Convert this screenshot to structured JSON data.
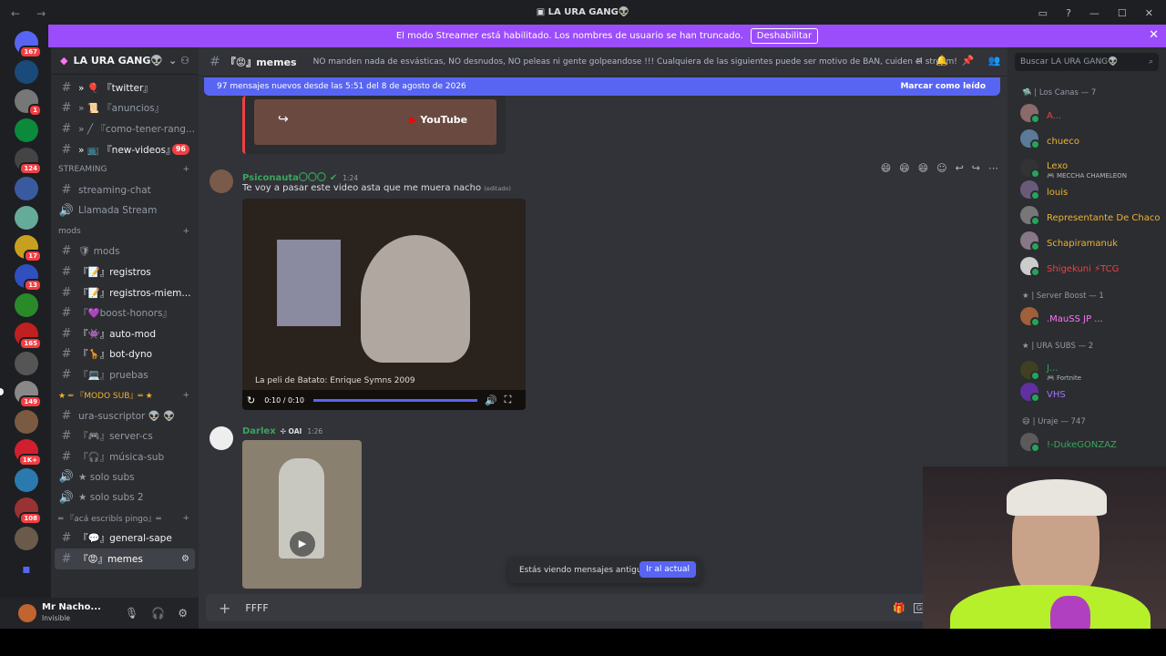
{
  "window": {
    "title": "LA URA GANG👽"
  },
  "banner": {
    "text": "El modo Streamer está habilitado. Los nombres de usuario se han truncado.",
    "button": "Deshabilitar"
  },
  "server_badges": [
    "167",
    "1",
    "124",
    "17",
    "13",
    "165",
    "149",
    "1K+",
    "108"
  ],
  "guild": {
    "name": "LA URA GANG👽"
  },
  "channels": [
    {
      "icon": "#",
      "label": "» 🎈 『twitter』",
      "unread": true
    },
    {
      "icon": "#",
      "label": "» 📜 『anuncios』",
      "unread": false
    },
    {
      "icon": "#",
      "label": "» ╱ 『como-tener-rang...",
      "unread": false
    },
    {
      "icon": "#",
      "label": "» 📺 『new-videos』",
      "unread": true,
      "badge": "96"
    }
  ],
  "cat_streaming": "STREAMING",
  "streaming": [
    {
      "icon": "#",
      "label": "streaming-chat"
    },
    {
      "icon": "🔊",
      "label": "Llamada Stream"
    }
  ],
  "cat_mods": "mods",
  "mods": [
    {
      "icon": "#",
      "label": "🛡 mods",
      "unread": false
    },
    {
      "icon": "#",
      "label": "『📝』registros",
      "unread": true
    },
    {
      "icon": "#",
      "label": "『📝』registros-miem...",
      "unread": true
    },
    {
      "icon": "#",
      "label": "『💜boost-honors』",
      "unread": false
    },
    {
      "icon": "#",
      "label": "『👾』auto-mod",
      "unread": true
    },
    {
      "icon": "#",
      "label": "『🦒』bot-dyno",
      "unread": true
    },
    {
      "icon": "#",
      "label": "『💻』pruebas",
      "unread": false
    }
  ],
  "cat_modosub": "★ ═ 『MODO SUB』═ ★",
  "modosub": [
    {
      "icon": "#",
      "label": "ura-suscriptor 👽 👽"
    },
    {
      "icon": "#",
      "label": "『🎮』server-cs"
    },
    {
      "icon": "#",
      "label": "『🎧』música-sub"
    },
    {
      "icon": "🔊",
      "label": "★ solo subs"
    },
    {
      "icon": "🔊",
      "label": "★ solo subs 2"
    }
  ],
  "cat_aca": "═ 『acá escribís pingo』═",
  "aca": [
    {
      "icon": "#",
      "label": "『💬』general-sape",
      "unread": true
    },
    {
      "icon": "#",
      "label": "『😡』memes",
      "active": true
    }
  ],
  "user": {
    "name": "Mr Nacho...",
    "status": "Invisible"
  },
  "channel_header": {
    "name": "『😡』memes",
    "topic": "NO manden nada de esvásticas, NO desnudos, NO peleas ni gente golpeandose !!! Cualquiera de las siguientes puede ser motivo de BAN, cuiden el stream!"
  },
  "new_messages": {
    "text": "97 mensajes nuevos desde las 5:51 del 8 de agosto de 2026",
    "mark": "Marcar como leído"
  },
  "embed_youtube": "YouTube",
  "messages": [
    {
      "author": "Psiconauta〇〇〇",
      "time": "1:24",
      "text": "Te voy a pasar este video asta que me muera nacho",
      "edited": "(editado)",
      "video_caption": "La peli de Batato: Enrique Symns 2009",
      "video_time": "0:10 / 0:10",
      "progress": 1.0
    },
    {
      "author": "Darlex",
      "tag": "OAI",
      "time": "1:26"
    }
  ],
  "jump": {
    "text": "Estás viendo mensajes antiguos",
    "button": "Ir al actual"
  },
  "composer": {
    "value": "FFFF"
  },
  "search": {
    "placeholder": "Buscar LA URA GANG👽"
  },
  "member_groups": [
    {
      "title": "🛸 | Los Canas — 7",
      "members": [
        {
          "name": "A...",
          "color": "#f23f43"
        },
        {
          "name": "chueco",
          "color": "#f0b232"
        },
        {
          "name": "Lexo",
          "color": "#f0b232",
          "sub": "🎮 MECCHA CHAMELEON"
        },
        {
          "name": "louis",
          "color": "#f0b232"
        },
        {
          "name": "Representante De Chaco",
          "color": "#f0b232"
        },
        {
          "name": "Schapiramanuk",
          "color": "#f0b232"
        },
        {
          "name": "Shigekuni ⚡TCG",
          "color": "#f23f43"
        }
      ]
    },
    {
      "title": "★ | Server Boost — 1",
      "members": [
        {
          "name": ".MauSS JP ...",
          "color": "#ff73fa"
        }
      ]
    },
    {
      "title": "★ | URA SUBS — 2",
      "members": [
        {
          "name": "J...",
          "color": "#3ba55c",
          "sub": "🎮 Fortnite"
        },
        {
          "name": "VHS",
          "color": "#a970ff"
        }
      ]
    },
    {
      "title": "😄 | Uraje — 747",
      "members": [
        {
          "name": "!-DukeGONZAZ",
          "color": "#3ba55c"
        }
      ]
    }
  ]
}
